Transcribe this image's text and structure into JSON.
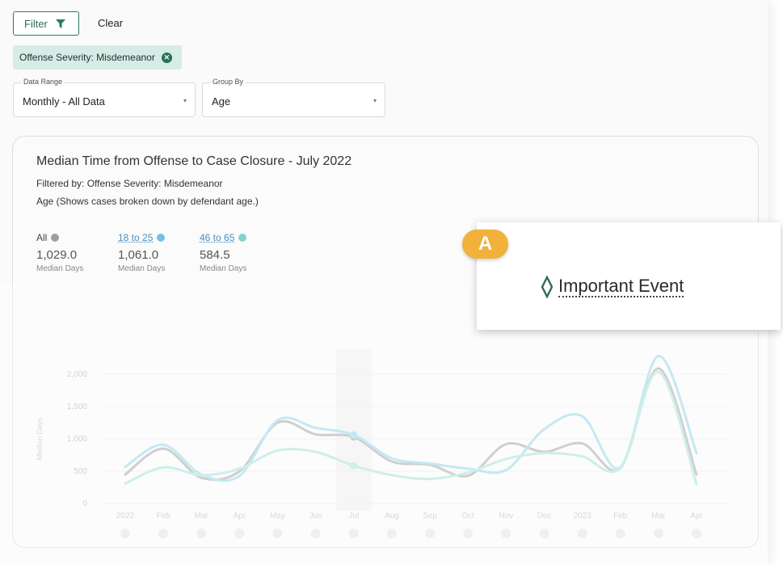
{
  "toolbar": {
    "filter_label": "Filter",
    "clear_label": "Clear",
    "active_filter": "Offense Severity: Misdemeanor"
  },
  "selects": {
    "data_range": {
      "label": "Data Range",
      "value": "Monthly - All Data"
    },
    "group_by": {
      "label": "Group By",
      "value": "Age"
    }
  },
  "chart_header": {
    "title": "Median Time from Offense to Case Closure - July 2022",
    "filtered_by": "Filtered by: Offense Severity: Misdemeanor",
    "group_note": "Age (Shows cases broken down by defendant age.)"
  },
  "stats": [
    {
      "label": "All",
      "value": "1,029.0",
      "unit": "Median Days",
      "color": "#9e9e9e"
    },
    {
      "label": "18 to 25",
      "value": "1,061.0",
      "unit": "Median Days",
      "color": "#6fc3e6"
    },
    {
      "label": "46 to 65",
      "value": "584.5",
      "unit": "Median Days",
      "color": "#7fd6cf"
    }
  ],
  "callout": {
    "badge": "A",
    "text": "Important Event"
  },
  "colors": {
    "accent": "#2e7a5f",
    "chip_bg": "#d6ece6",
    "badge": "#f0b23a"
  },
  "chart_data": {
    "type": "line",
    "categories": [
      "2022",
      "Feb",
      "Mar",
      "Apr",
      "May",
      "Jun",
      "Jul",
      "Aug",
      "Sep",
      "Oct",
      "Nov",
      "Dec",
      "2023",
      "Feb",
      "Mar",
      "Apr"
    ],
    "ylabel": "Median Days",
    "ylim": [
      0,
      2000
    ],
    "yticks": [
      0,
      500,
      1000,
      1500,
      2000
    ],
    "ytick_labels": [
      "0",
      "500",
      "1,000",
      "1,500",
      "2,000"
    ],
    "highlight_category": "Jul",
    "series": [
      {
        "name": "All",
        "color": "#b5b5b5",
        "values": [
          450,
          850,
          400,
          500,
          1250,
          1070,
          1029,
          650,
          600,
          430,
          920,
          800,
          930,
          550,
          2090,
          450
        ]
      },
      {
        "name": "18 to 25",
        "color": "#a6dcef",
        "values": [
          570,
          910,
          450,
          430,
          1290,
          1170,
          1061,
          700,
          620,
          540,
          520,
          1150,
          1350,
          560,
          2280,
          780
        ]
      },
      {
        "name": "46 to 65",
        "color": "#b4e6de",
        "values": [
          310,
          560,
          440,
          540,
          820,
          800,
          584.5,
          440,
          380,
          480,
          690,
          780,
          730,
          560,
          2040,
          300
        ]
      }
    ]
  }
}
